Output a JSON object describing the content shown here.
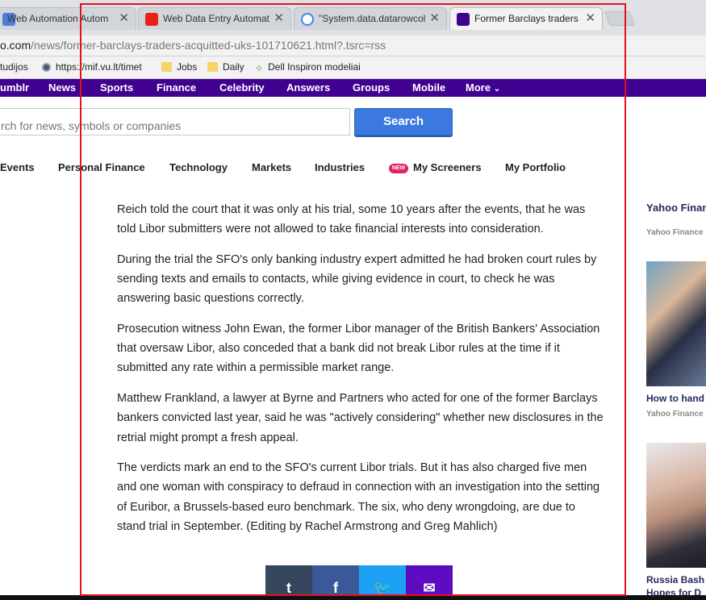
{
  "tabs": [
    {
      "title": "Web Automation  Autom",
      "favicon": "bars-icon",
      "color": "#4a7fd6"
    },
    {
      "title": "Web Data Entry Automat",
      "favicon": "youtube-icon",
      "color": "#e62117"
    },
    {
      "title": "\"System.data.datarowcoll",
      "favicon": "google-icon",
      "color": "#4285f4"
    },
    {
      "title": "Former Barclays traders a",
      "favicon": "yahoo-icon",
      "color": "#400090"
    }
  ],
  "tab_close": "✕",
  "address": {
    "host_prefix": "o.com",
    "path": "/news/former-barclays-traders-acquitted-uks-101710621.html?.tsrc=rss"
  },
  "bookmarks": [
    "tudijos",
    "https://mif.vu.lt/timet",
    "Jobs",
    "Daily",
    "Dell Inspiron modeliai"
  ],
  "yahoo_nav": [
    "umblr",
    "News",
    "Sports",
    "Finance",
    "Celebrity",
    "Answers",
    "Groups",
    "Mobile",
    "More"
  ],
  "search": {
    "placeholder": "rch for news, symbols or companies",
    "button": "Search"
  },
  "finance_nav": [
    "Events",
    "Personal Finance",
    "Technology",
    "Markets",
    "Industries",
    "My Screeners",
    "My Portfolio"
  ],
  "new_badge": "NEW",
  "article": {
    "paragraphs": [
      "Reich told the court that it was only at his trial, some 10 years after the events, that he was told Libor submitters were not allowed to take financial interests into consideration.",
      "During the trial the SFO's only banking industry expert admitted he had broken court rules by sending texts and emails to contacts, while giving evidence in court, to check he was answering basic questions correctly.",
      "Prosecution witness John Ewan, the former Libor manager of the British Bankers' Association that oversaw Libor, also conceded that a bank did not break Libor rules at the time if it submitted any rate within a permissible market range.",
      "Matthew Frankland, a lawyer at Byrne and Partners who acted for one of the former Barclays bankers convicted last year, said he was \"actively considering\" whether new disclosures in the retrial might prompt a fresh appeal.",
      "The verdicts mark an end to the SFO's current Libor trials. But it has also charged five men and one woman with conspiracy to defraud in connection with an investigation into the setting of Euribor, a Brussels-based euro benchmark. The six, who deny wrongdoing, are due to stand trial in September. (Editing by Rachel Armstrong and Greg Mahlich)"
    ]
  },
  "sidebar": {
    "heading": "Yahoo Finan",
    "heading_source": "Yahoo Finance",
    "item1_title": "How to hand",
    "item1_source": "Yahoo Finance",
    "item2_title": "Russia Bash",
    "item2_title_line2": "Hopes for D"
  },
  "share": {
    "tumblr": "t",
    "facebook": "f",
    "twitter": "🐦",
    "mail": "✉"
  },
  "colors": {
    "yahoo_purple": "#400090",
    "search_blue": "#3b79e0",
    "highlight_red": "#e0131b"
  }
}
